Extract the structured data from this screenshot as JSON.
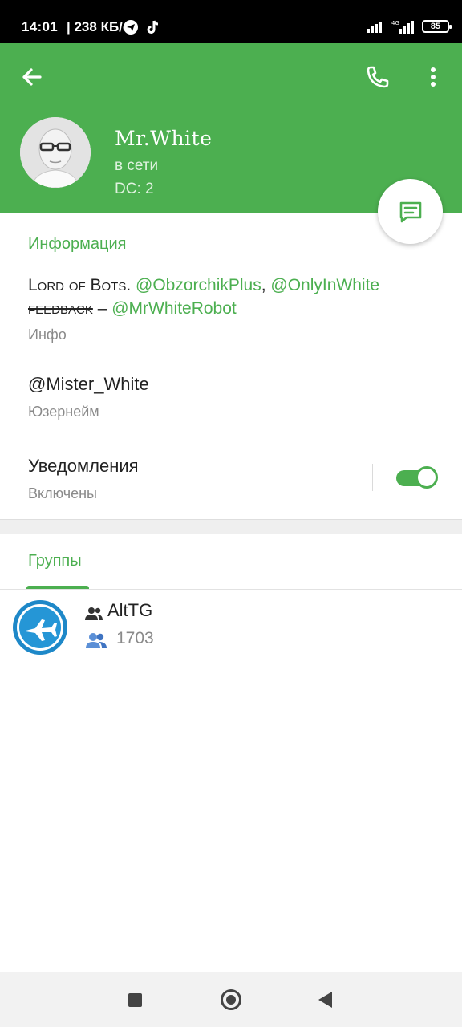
{
  "status_bar": {
    "time": "14:01",
    "network_speed": "| 238 КБ/с",
    "battery": "85",
    "network_type": "4G"
  },
  "header": {
    "name": "Mr.White",
    "status": "в сети",
    "dc": "DC: 2",
    "background_color": "#4caf50"
  },
  "info": {
    "section_title": "Информация",
    "bio": {
      "part1": "Lord of Bots. ",
      "link1": "@ObzorchikPlus",
      "sep": ", ",
      "link2": "@OnlyInWhite",
      "part2": "feedback",
      "dash": " – ",
      "link3": "@MrWhiteRobot"
    },
    "bio_label": "Инфо",
    "username": "@Mister_White",
    "username_label": "Юзернейм",
    "notifications_title": "Уведомления",
    "notifications_state": "Включены",
    "notifications_on": true
  },
  "groups": {
    "tab_label": "Группы",
    "items": [
      {
        "name": "AltTG",
        "members": "1703"
      }
    ]
  },
  "icons": {
    "back": "arrow-left-icon",
    "call": "phone-icon",
    "more": "more-vertical-icon",
    "message": "message-icon",
    "group": "group-icon",
    "members": "members-icon"
  },
  "colors": {
    "accent": "#4caf50",
    "link": "#4caf50",
    "secondary_text": "#8a8a8a"
  }
}
